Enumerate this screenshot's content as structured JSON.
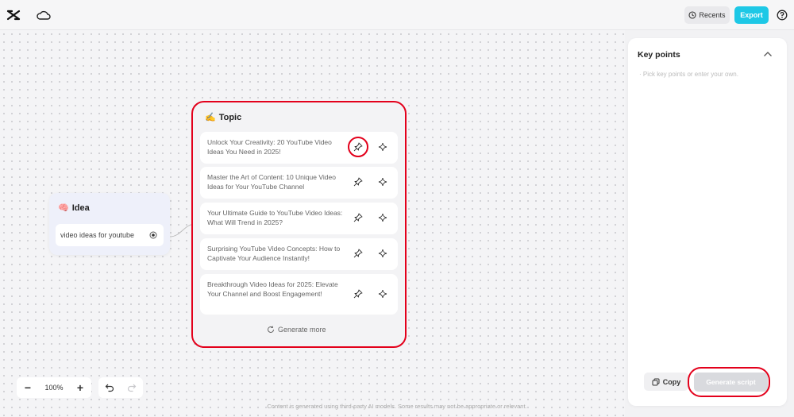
{
  "header": {
    "recents_label": "Recents",
    "export_label": "Export",
    "icons": [
      "logo-icon",
      "cloud-icon",
      "clock-icon",
      "help-icon"
    ]
  },
  "idea": {
    "title": "Idea",
    "emoji": "🧠",
    "input_value": "video ideas for youtube"
  },
  "topic": {
    "title": "Topic",
    "emoji": "✍️",
    "items": [
      {
        "text": "Unlock Your Creativity: 20 YouTube Video Ideas You Need in 2025!"
      },
      {
        "text": "Master the Art of Content: 10 Unique Video Ideas for Your YouTube Channel"
      },
      {
        "text": "Your Ultimate Guide to YouTube Video Ideas: What Will Trend in 2025?"
      },
      {
        "text": "Surprising YouTube Video Concepts: How to Captivate Your Audience Instantly!"
      },
      {
        "text": "Breakthrough Video Ideas for 2025: Elevate Your Channel and Boost Engagement!"
      }
    ],
    "generate_more_label": "Generate more"
  },
  "zoom": {
    "level": "100%"
  },
  "disclaimer": "Content is generated using third-party AI models. Some results may not be appropriate or relevant.",
  "panel": {
    "title": "Key points",
    "placeholder": "· Pick key points or enter your own.",
    "copy_label": "Copy",
    "generate_script_label": "Generate script"
  },
  "colors": {
    "accent": "#1ec8e6",
    "highlight": "#e3001b"
  }
}
